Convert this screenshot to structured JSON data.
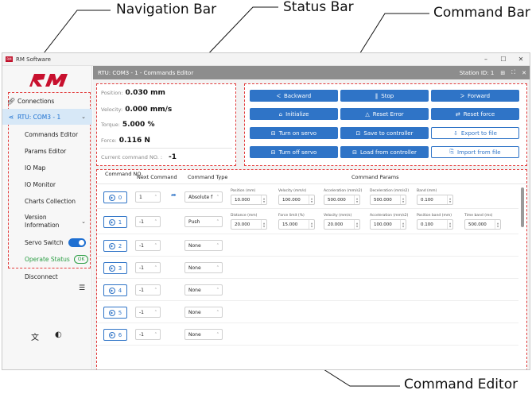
{
  "callouts": {
    "navigation_bar": "Navigation Bar",
    "status_bar": "Status Bar",
    "command_bar": "Command Bar",
    "command_editor": "Command Editor"
  },
  "window": {
    "title": "RM Software",
    "minimize": "–",
    "maximize": "☐",
    "close": "✕"
  },
  "sidebar": {
    "connections": "Connections",
    "device": "RTU: COM3 - 1",
    "items": [
      "Commands Editor",
      "Params Editor",
      "IO Map",
      "IO Monitor",
      "Charts Collection",
      "Version Information"
    ],
    "servo_switch": "Servo Switch",
    "operate_status": "Operate Status",
    "operate_badge": "OK",
    "disconnect": "Disconnect"
  },
  "statusbar": {
    "title": "RTU: COM3 - 1 - Commands Editor",
    "station": "Station ID: 1"
  },
  "status": {
    "position_label": "Position:",
    "position_value": "0.030 mm",
    "velocity_label": "Velocity:",
    "velocity_value": "0.000 mm/s",
    "torque_label": "Torque:",
    "torque_value": "5.000 %",
    "force_label": "Force:",
    "force_value": "0.116 N",
    "current_label": "Current command NO. :",
    "current_value": "-1"
  },
  "commands": {
    "backward": "Backward",
    "stop": "Stop",
    "forward": "Forward",
    "initialize": "Initialize",
    "reset_error": "Reset Error",
    "reset_force": "Reset force",
    "turn_on_servo": "Turn on servo",
    "save_to_controller": "Save to controller",
    "export_to_file": "Export to file",
    "turn_off_servo": "Turn off servo",
    "load_from_controller": "Load from controller",
    "import_from_file": "Import from file"
  },
  "editor": {
    "headers": {
      "command_no": "Command NO.",
      "next_command": "Next Command",
      "command_type": "Command Type",
      "command_params": "Command Params"
    },
    "rows": [
      {
        "no": "0",
        "next": "1",
        "type": "Absolute f",
        "params": [
          {
            "label": "Position (mm)",
            "value": "10.000"
          },
          {
            "label": "Velocity (mm/s)",
            "value": "100.000"
          },
          {
            "label": "Acceleration (mm/s2)",
            "value": "500.000"
          },
          {
            "label": "Deceleration (mm/s2)",
            "value": "500.000"
          },
          {
            "label": "Band (mm)",
            "value": "0.100"
          }
        ]
      },
      {
        "no": "1",
        "next": "-1",
        "type": "Push",
        "params": [
          {
            "label": "Distance (mm)",
            "value": "20.000"
          },
          {
            "label": "Force limit (%)",
            "value": "15.000"
          },
          {
            "label": "Velocity (mm/s)",
            "value": "20.000"
          },
          {
            "label": "Acceleration (mm/s2)",
            "value": "100.000"
          },
          {
            "label": "Position band (mm)",
            "value": "0.100"
          },
          {
            "label": "Time band (ms)",
            "value": "500.000"
          }
        ]
      },
      {
        "no": "2",
        "next": "-1",
        "type": "None",
        "params": []
      },
      {
        "no": "3",
        "next": "-1",
        "type": "None",
        "params": []
      },
      {
        "no": "4",
        "next": "-1",
        "type": "None",
        "params": []
      },
      {
        "no": "5",
        "next": "-1",
        "type": "None",
        "params": []
      },
      {
        "no": "6",
        "next": "-1",
        "type": "None",
        "params": []
      }
    ]
  },
  "colors": {
    "accent": "#2f74c7",
    "highlight": "#e23a3a",
    "status_bar": "#8d8d8d",
    "ok": "#2a9d43"
  }
}
